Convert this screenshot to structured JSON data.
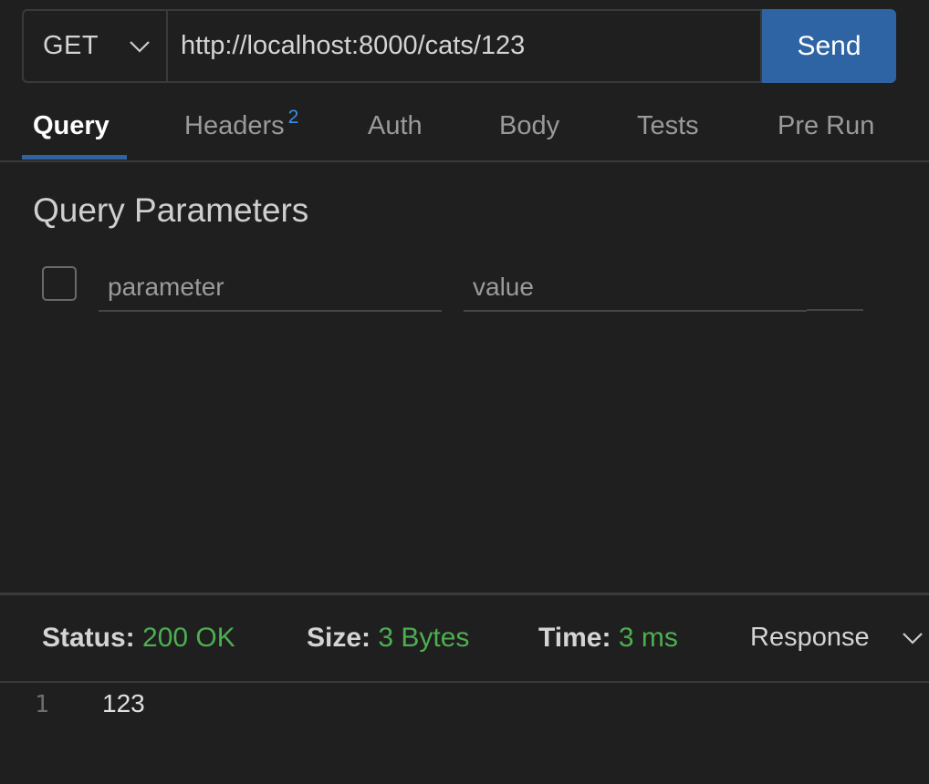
{
  "request": {
    "method": "GET",
    "url": "http://localhost:8000/cats/123",
    "send_label": "Send"
  },
  "tabs": [
    {
      "label": "Query",
      "active": true
    },
    {
      "label": "Headers",
      "badge": "2"
    },
    {
      "label": "Auth"
    },
    {
      "label": "Body"
    },
    {
      "label": "Tests"
    },
    {
      "label": "Pre Run"
    }
  ],
  "query": {
    "title": "Query Parameters",
    "param_placeholder": "parameter",
    "value_placeholder": "value"
  },
  "response": {
    "status_label": "Status:",
    "status_value": "200 OK",
    "size_label": "Size:",
    "size_value": "3 Bytes",
    "time_label": "Time:",
    "time_value": "3 ms",
    "view_label": "Response",
    "lines": [
      {
        "number": "1",
        "content": "123"
      }
    ]
  },
  "colors": {
    "background": "#1f1f1f",
    "accent": "#2e64a3",
    "success": "#4caf50",
    "badge": "#3b8eea"
  },
  "icons": {
    "method_dropdown": "chevron-down-icon",
    "response_dropdown": "chevron-down-icon"
  }
}
